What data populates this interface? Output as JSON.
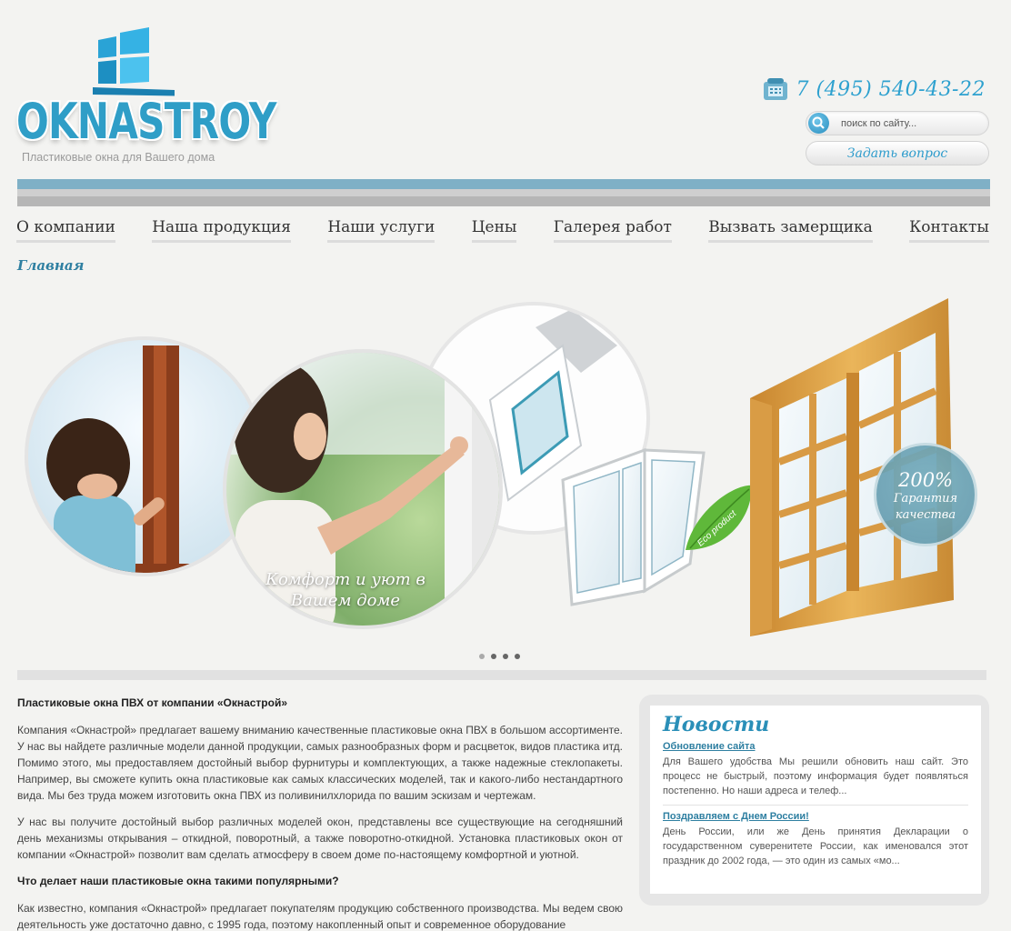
{
  "header": {
    "logo_text": "OKNASTROY",
    "tagline": "Пластиковые окна для Вашего дома",
    "phone": "7 (495) 540-43-22",
    "search_placeholder": "поиск по сайту...",
    "ask_button": "Задать вопрос"
  },
  "nav": {
    "items": [
      "О компании",
      "Наша продукция",
      "Наши услуги",
      "Цены",
      "Галерея работ",
      "Вызвать замерщика",
      "Контакты"
    ]
  },
  "breadcrumb": "Главная",
  "slider": {
    "caption": "Комфорт и уют в Вашем доме",
    "eco_label": "Eco product",
    "badge_percent": "200%",
    "badge_text": "Гарантия качества",
    "dots_count": 4,
    "active_dot": 0
  },
  "article": {
    "heading": "Пластиковые окна ПВХ от компании «Окнастрой»",
    "p1": "Компания «Окнастрой» предлагает вашему вниманию качественные пластиковые окна ПВХ в большом ассортименте. У нас вы найдете различные модели данной продукции, самых разнообразных форм и расцветок, видов пластика итд. Помимо этого, мы предоставляем достойный выбор фурнитуры и комплектующих, а также надежные стеклопакеты. Например, вы сможете купить окна пластиковые как самых классических моделей, так и какого-либо нестандартного вида. Мы без труда можем изготовить окна ПВХ из поливинилхлорида по вашим эскизам и чертежам.",
    "p2": "У нас вы получите достойный выбор различных моделей окон, представлены все существующие на сегодняшний день механизмы открывания – откидной, поворотный, а также поворотно-откидной. Установка пластиковых окон от компании «Окнастрой» позволит вам сделать атмосферу в своем доме по-настоящему комфортной и уютной.",
    "subheading": "Что делает наши пластиковые окна такими популярными?",
    "p3": "Как известно, компания «Окнастрой» предлагает покупателям продукцию собственного производства. Мы ведем свою деятельность уже достаточно давно, с 1995 года, поэтому накопленный опыт и современное оборудование"
  },
  "news": {
    "title": "Новости",
    "items": [
      {
        "title": "Обновление сайта",
        "text": "Для Вашего удобства Мы решили обновить наш сайт. Это процесс не быстрый, поэтому информация будет появляться постепенно. Но наши адреса и телеф..."
      },
      {
        "title": "Поздравляем с Днем России!",
        "text": "День России, или же День принятия Декларации о государственном суверенитете России, как именовался этот праздник до 2002 года, — это один из самых «мо..."
      }
    ]
  },
  "colors": {
    "accent": "#2ea1cf",
    "link": "#2e7fa1",
    "band_blue": "#7fb0c6",
    "frame_wood": "#e2a84a"
  }
}
